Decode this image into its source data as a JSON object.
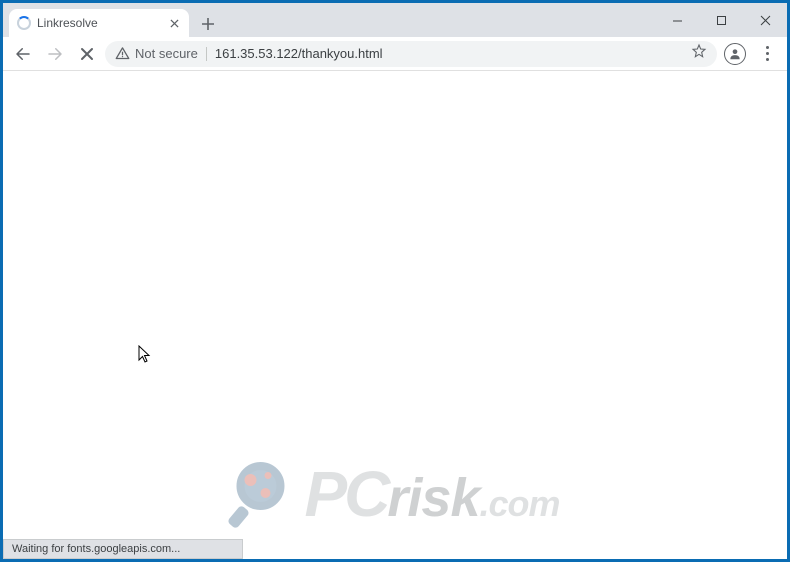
{
  "tab": {
    "title": "Linkresolve",
    "loading": true
  },
  "security": {
    "label": "Not secure"
  },
  "url": "161.35.53.122/thankyou.html",
  "status": "Waiting for fonts.googleapis.com...",
  "watermark": {
    "pc": "PC",
    "risk": "risk",
    "com": ".com"
  }
}
